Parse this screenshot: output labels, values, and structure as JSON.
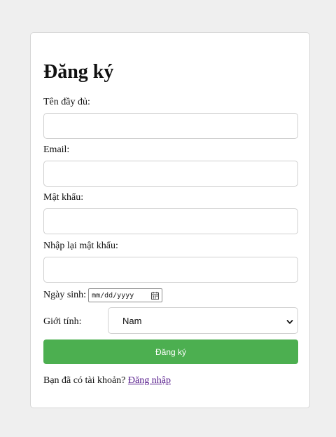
{
  "form": {
    "title": "Đăng ký",
    "fullname_label": "Tên đầy đủ:",
    "email_label": "Email:",
    "password_label": "Mật khẩu:",
    "confirm_password_label": "Nhập lại mật khẩu:",
    "dob_label": "Ngày sinh:",
    "dob_placeholder": "mm/dd/yyyy",
    "gender_label": "Giới tính:",
    "gender_selected": "Nam",
    "submit_label": "Đăng ký",
    "footer_text": "Bạn đã có tài khoản?",
    "login_link": "Đăng nhập"
  },
  "colors": {
    "page_background": "#efefef",
    "submit_button": "#4caf50",
    "link_visited": "#551a8b"
  },
  "icons": {
    "date_picker": "calendar-icon",
    "select_arrow": "chevron-down-icon"
  }
}
